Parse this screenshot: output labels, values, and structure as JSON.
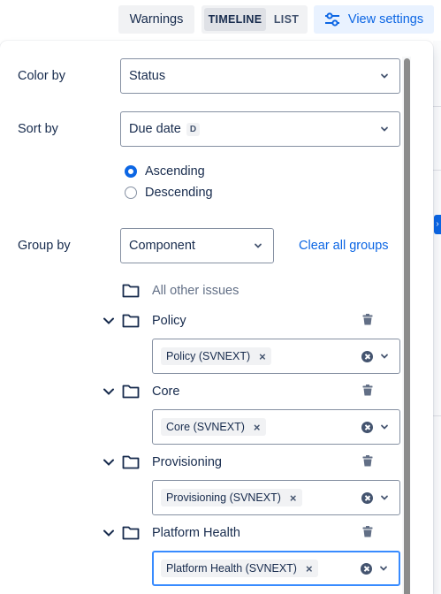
{
  "toolbar": {
    "warnings_label": "Warnings",
    "timeline_label": "TIMELINE",
    "list_label": "LIST",
    "view_settings_label": "View settings",
    "accent_color": "#0c66e4"
  },
  "settings": {
    "color_by": {
      "label": "Color by",
      "value": "Status"
    },
    "sort_by": {
      "label": "Sort by",
      "value": "Due date",
      "badge": "D"
    },
    "order": {
      "ascending_label": "Ascending",
      "descending_label": "Descending",
      "selected": "Ascending"
    },
    "group_by": {
      "label": "Group by",
      "value": "Component",
      "clear_label": "Clear all groups"
    }
  },
  "groups": {
    "other_label": "All other issues",
    "items": [
      {
        "name": "Policy",
        "tag": "Policy (SVNEXT)"
      },
      {
        "name": "Core",
        "tag": "Core (SVNEXT)"
      },
      {
        "name": "Provisioning",
        "tag": "Provisioning (SVNEXT)"
      },
      {
        "name": "Platform Health",
        "tag": "Platform Health (SVNEXT)"
      }
    ]
  }
}
